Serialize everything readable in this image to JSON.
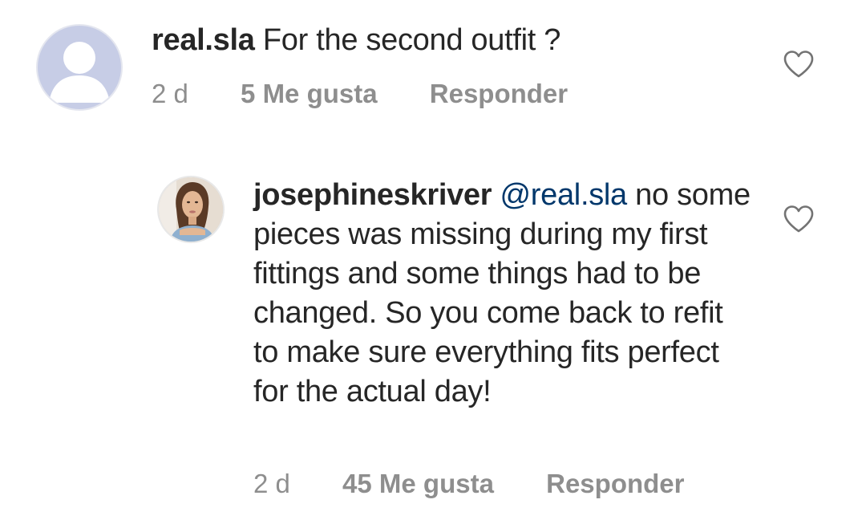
{
  "comments": [
    {
      "username": "real.sla",
      "text": "For the second outfit ?",
      "time": "2 d",
      "likes": "5 Me gusta",
      "reply": "Responder",
      "avatar": "default-avatar-icon"
    },
    {
      "username": "josephineskriver",
      "mention": "@real.sla",
      "text": "no some pieces was missing during my first fittings and some things had to be changed. So you come back to refit to make sure everything fits perfect for the actual day!",
      "time": "2 d",
      "likes": "45 Me gusta",
      "reply": "Responder",
      "avatar": "profile-photo"
    }
  ],
  "icons": {
    "like": "heart-outline-icon"
  },
  "colors": {
    "text": "#262626",
    "meta": "#8e8e8e",
    "mention": "#00376b",
    "avatar_default": "#c7cde6"
  }
}
